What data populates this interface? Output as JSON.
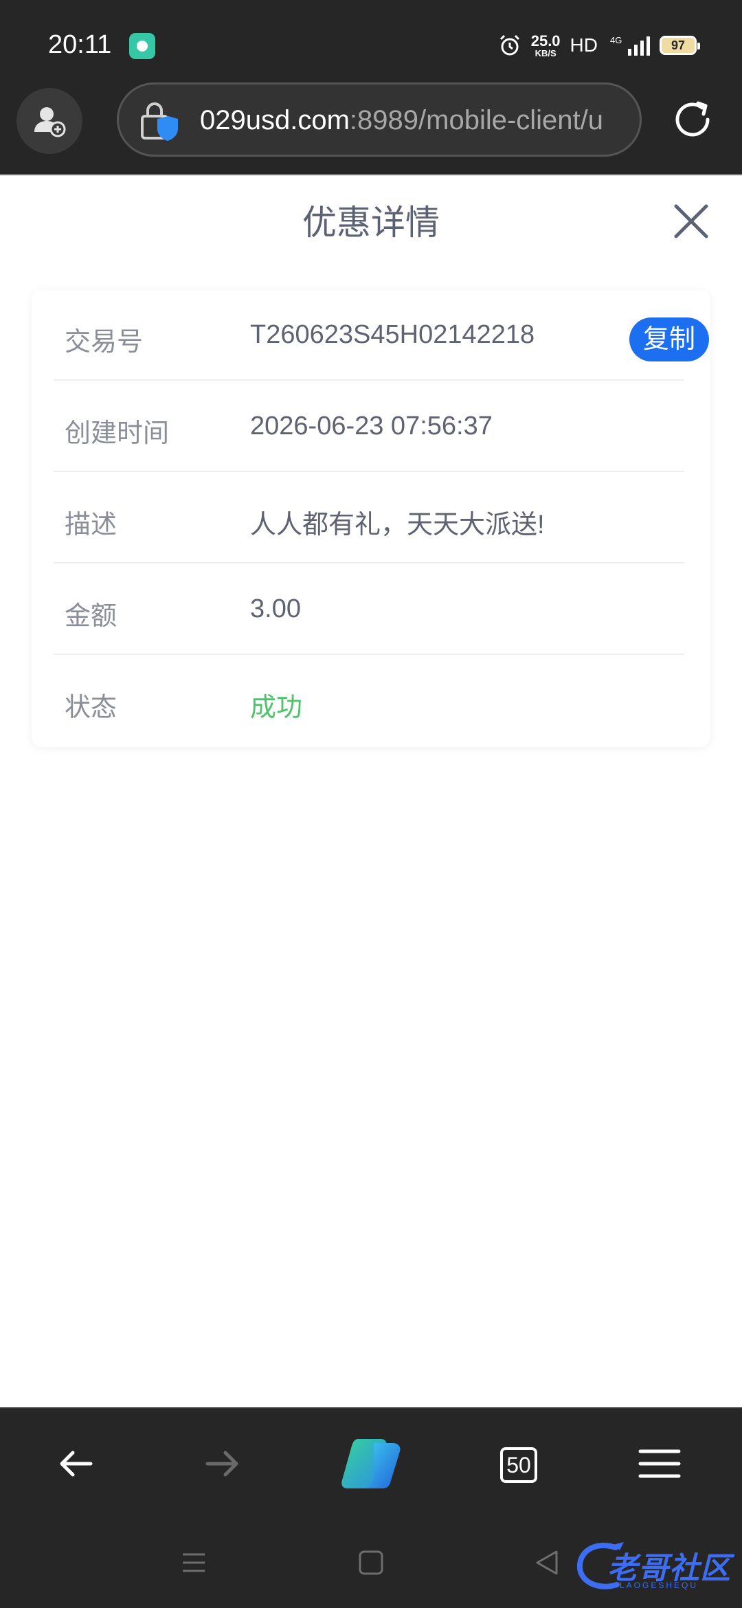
{
  "status_bar": {
    "time": "20:11",
    "network_speed": "25.0",
    "network_speed_unit": "KB/S",
    "hd_label": "HD",
    "network_type": "4G",
    "battery": "97"
  },
  "browser": {
    "url_host": "029usd.com",
    "url_path": ":8989/mobile-client/u",
    "tab_count": "50"
  },
  "page": {
    "title": "优惠详情",
    "copy_label": "复制",
    "rows": [
      {
        "label": "交易号",
        "value": "T260623S45H02142218"
      },
      {
        "label": "创建时间",
        "value": "2026-06-23 07:56:37"
      },
      {
        "label": "描述",
        "value": "人人都有礼，天天大派送!"
      },
      {
        "label": "金额",
        "value": "3.00"
      },
      {
        "label": "状态",
        "value": "成功"
      }
    ],
    "status_color": "#4fc26b",
    "accent_color": "#1c6ff0"
  },
  "watermark": {
    "text": "老哥社区",
    "subtext": "LAOGESHEQU"
  },
  "icons": {
    "profile": "add-user-icon",
    "lock": "lock-shield-icon",
    "reload": "reload-icon",
    "close": "close-icon",
    "back": "back-arrow-icon",
    "forward": "forward-arrow-icon",
    "copilot": "copilot-icon",
    "menu": "hamburger-menu-icon"
  }
}
